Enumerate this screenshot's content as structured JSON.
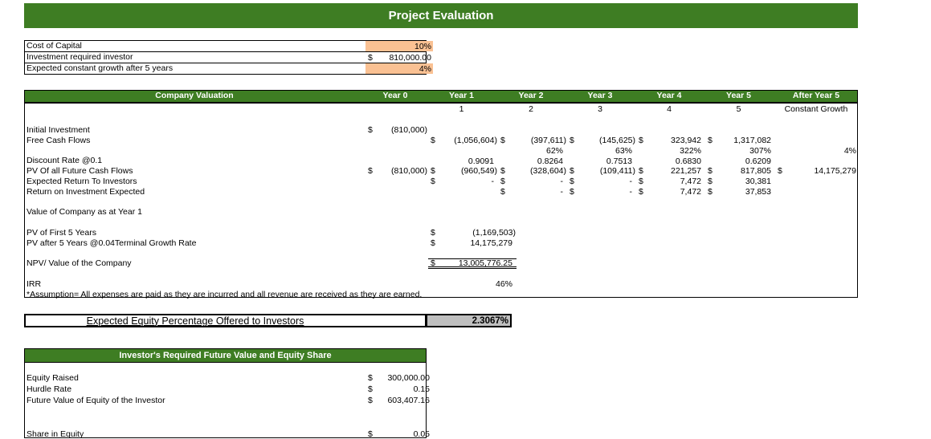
{
  "title": "Project Evaluation",
  "colors": {
    "green": "#3E7D23",
    "orange": "#FAC193",
    "gray": "#BFBFBF",
    "border": "#000000"
  },
  "inputs": {
    "rows": [
      {
        "label": "Cost of Capital",
        "currency": "",
        "value": "10%",
        "highlight": true
      },
      {
        "label": "Investment required investor",
        "currency": "$",
        "value": "810,000.00",
        "highlight": false
      },
      {
        "label": "Expected constant growth after 5 years",
        "currency": "",
        "value": "4%",
        "highlight": true
      }
    ]
  },
  "valuation": {
    "header": "Company Valuation",
    "col_headers": [
      "Year 0",
      "Year 1",
      "Year 2",
      "Year 3",
      "Year 4",
      "Year 5",
      "After Year 5"
    ],
    "sub_headers": [
      "",
      "1",
      "2",
      "3",
      "4",
      "5",
      "Constant Growth"
    ],
    "columns": [
      "year0",
      "year1",
      "year2",
      "year3",
      "year4",
      "year5",
      "after"
    ],
    "rows": [
      {
        "label": "",
        "cells": {}
      },
      {
        "label": "Initial Investment",
        "cells": {
          "year0": {
            "d": "$",
            "v": "(810,000)"
          }
        }
      },
      {
        "label": "Free Cash Flows",
        "cells": {
          "year1": {
            "d": "$",
            "v": "(1,056,604)"
          },
          "year2": {
            "d": "$",
            "v": "(397,611)"
          },
          "year3": {
            "d": "$",
            "v": "(145,625)"
          },
          "year4": {
            "d": "$",
            "v": "323,942"
          },
          "year5": {
            "d": "$",
            "v": "1,317,082"
          }
        }
      },
      {
        "label": "",
        "cells": {
          "year2": {
            "v": "62%"
          },
          "year3": {
            "v": "63%"
          },
          "year4": {
            "v": "322%"
          },
          "year5": {
            "v": "307%"
          },
          "after": {
            "v": "4%"
          }
        }
      },
      {
        "label": "Discount Rate @0.1",
        "cells": {
          "year1": {
            "v": "0.9091"
          },
          "year2": {
            "v": "0.8264"
          },
          "year3": {
            "v": "0.7513"
          },
          "year4": {
            "v": "0.6830"
          },
          "year5": {
            "v": "0.6209"
          }
        }
      },
      {
        "label": "PV Of all Future Cash Flows",
        "cells": {
          "year0": {
            "d": "$",
            "v": "(810,000)"
          },
          "year1": {
            "d": "$",
            "v": "(960,549)"
          },
          "year2": {
            "d": "$",
            "v": "(328,604)"
          },
          "year3": {
            "d": "$",
            "v": "(109,411)"
          },
          "year4": {
            "d": "$",
            "v": "221,257"
          },
          "year5": {
            "d": "$",
            "v": "817,805"
          },
          "after": {
            "d": "$",
            "v": "14,175,279"
          }
        }
      },
      {
        "label": "Expected Return To Investors",
        "cells": {
          "year1": {
            "d": "$",
            "v": "-"
          },
          "year2": {
            "d": "$",
            "v": "-"
          },
          "year3": {
            "d": "$",
            "v": "-"
          },
          "year4": {
            "d": "$",
            "v": "7,472"
          },
          "year5": {
            "d": "$",
            "v": "30,381"
          }
        }
      },
      {
        "label": "Return on Investment Expected",
        "cells": {
          "year2": {
            "d": "$",
            "v": "-"
          },
          "year3": {
            "d": "$",
            "v": "-"
          },
          "year4": {
            "d": "$",
            "v": "7,472"
          },
          "year5": {
            "d": "$",
            "v": "37,853"
          }
        }
      },
      {
        "label": "",
        "cells": {}
      },
      {
        "label": "Value of Company as at Year 1",
        "cells": {}
      },
      {
        "label": "",
        "cells": {}
      },
      {
        "label": "PV of First 5 Years",
        "wide": true,
        "cells": {
          "year1": {
            "d": "$",
            "v": "(1,169,503)"
          }
        }
      },
      {
        "label": "PV after 5 Years @0.04Terminal Growth Rate",
        "wide": true,
        "cells": {
          "year1": {
            "d": "$",
            "v": "14,175,279"
          }
        }
      },
      {
        "label": "",
        "cells": {}
      },
      {
        "label": "NPV/ Value of the Company",
        "wide": true,
        "npv": true,
        "cells": {
          "year1": {
            "d": "$",
            "v": "13,005,776.25"
          }
        }
      },
      {
        "label": "",
        "cells": {}
      },
      {
        "label": "IRR",
        "wide": true,
        "cells": {
          "year1": {
            "v": "46%"
          }
        }
      },
      {
        "label": "*Assumption= All expenses are paid as they are incurred and all revenue are received as they are earned.",
        "cells": {}
      }
    ]
  },
  "equity_offer": {
    "label": "Expected Equity Percentage Offered to Investors",
    "value": "2.3067%"
  },
  "investor": {
    "header": "Investor's Required Future Value and Equity Share",
    "rows": [
      {
        "label": "Equity Raised",
        "currency": "$",
        "value": "300,000.00"
      },
      {
        "label": "Hurdle Rate",
        "currency": "$",
        "value": "0.15"
      },
      {
        "label": "Future Value of Equity of the Investor",
        "currency": "$",
        "value": "603,407.16"
      },
      {
        "label": "Share in Equity",
        "currency": "$",
        "value": "0.05"
      }
    ]
  }
}
